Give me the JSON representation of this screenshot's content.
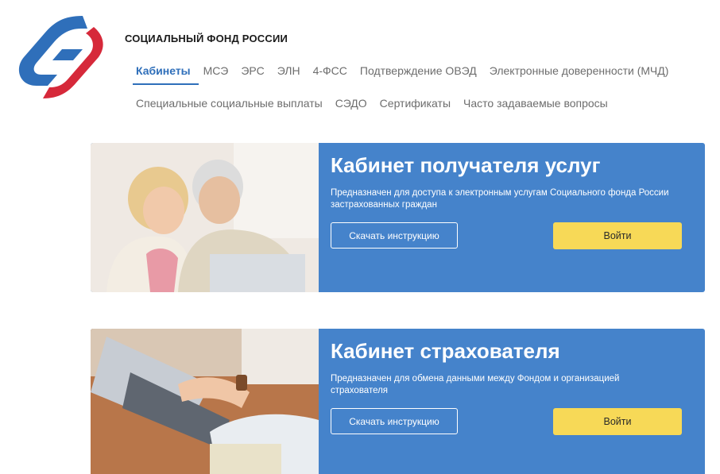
{
  "header": {
    "org_name": "СОЦИАЛЬНЫЙ ФОНД РОССИИ",
    "logo_icon": "sfr-logo-icon",
    "brand_colors": {
      "blue": "#2f6fba",
      "red": "#d6293a"
    }
  },
  "nav": {
    "row1": [
      {
        "label": "Кабинеты",
        "active": true
      },
      {
        "label": "МСЭ"
      },
      {
        "label": "ЭРС"
      },
      {
        "label": "ЭЛН"
      },
      {
        "label": "4-ФСС"
      },
      {
        "label": "Подтверждение ОВЭД"
      },
      {
        "label": "Электронные доверенности (МЧД)"
      }
    ],
    "row2": [
      {
        "label": "Специальные социальные выплаты"
      },
      {
        "label": "СЭДО"
      },
      {
        "label": "Сертификаты"
      },
      {
        "label": "Часто задаваемые вопросы"
      }
    ]
  },
  "cards": [
    {
      "title": "Кабинет получателя услуг",
      "description": "Предназначен для доступа к электронным услугам Социального фонда России застрахованных граждан",
      "instruction_button": "Скачать инструкцию",
      "login_button": "Войти"
    },
    {
      "title": "Кабинет страхователя",
      "description": "Предназначен для обмена данными между Фондом и организацией страхователя",
      "instruction_button": "Скачать инструкцию",
      "login_button": "Войти"
    }
  ],
  "colors": {
    "card_bg": "#4583cb",
    "login_button_bg": "#f7d957",
    "active_nav": "#2f6fba"
  }
}
